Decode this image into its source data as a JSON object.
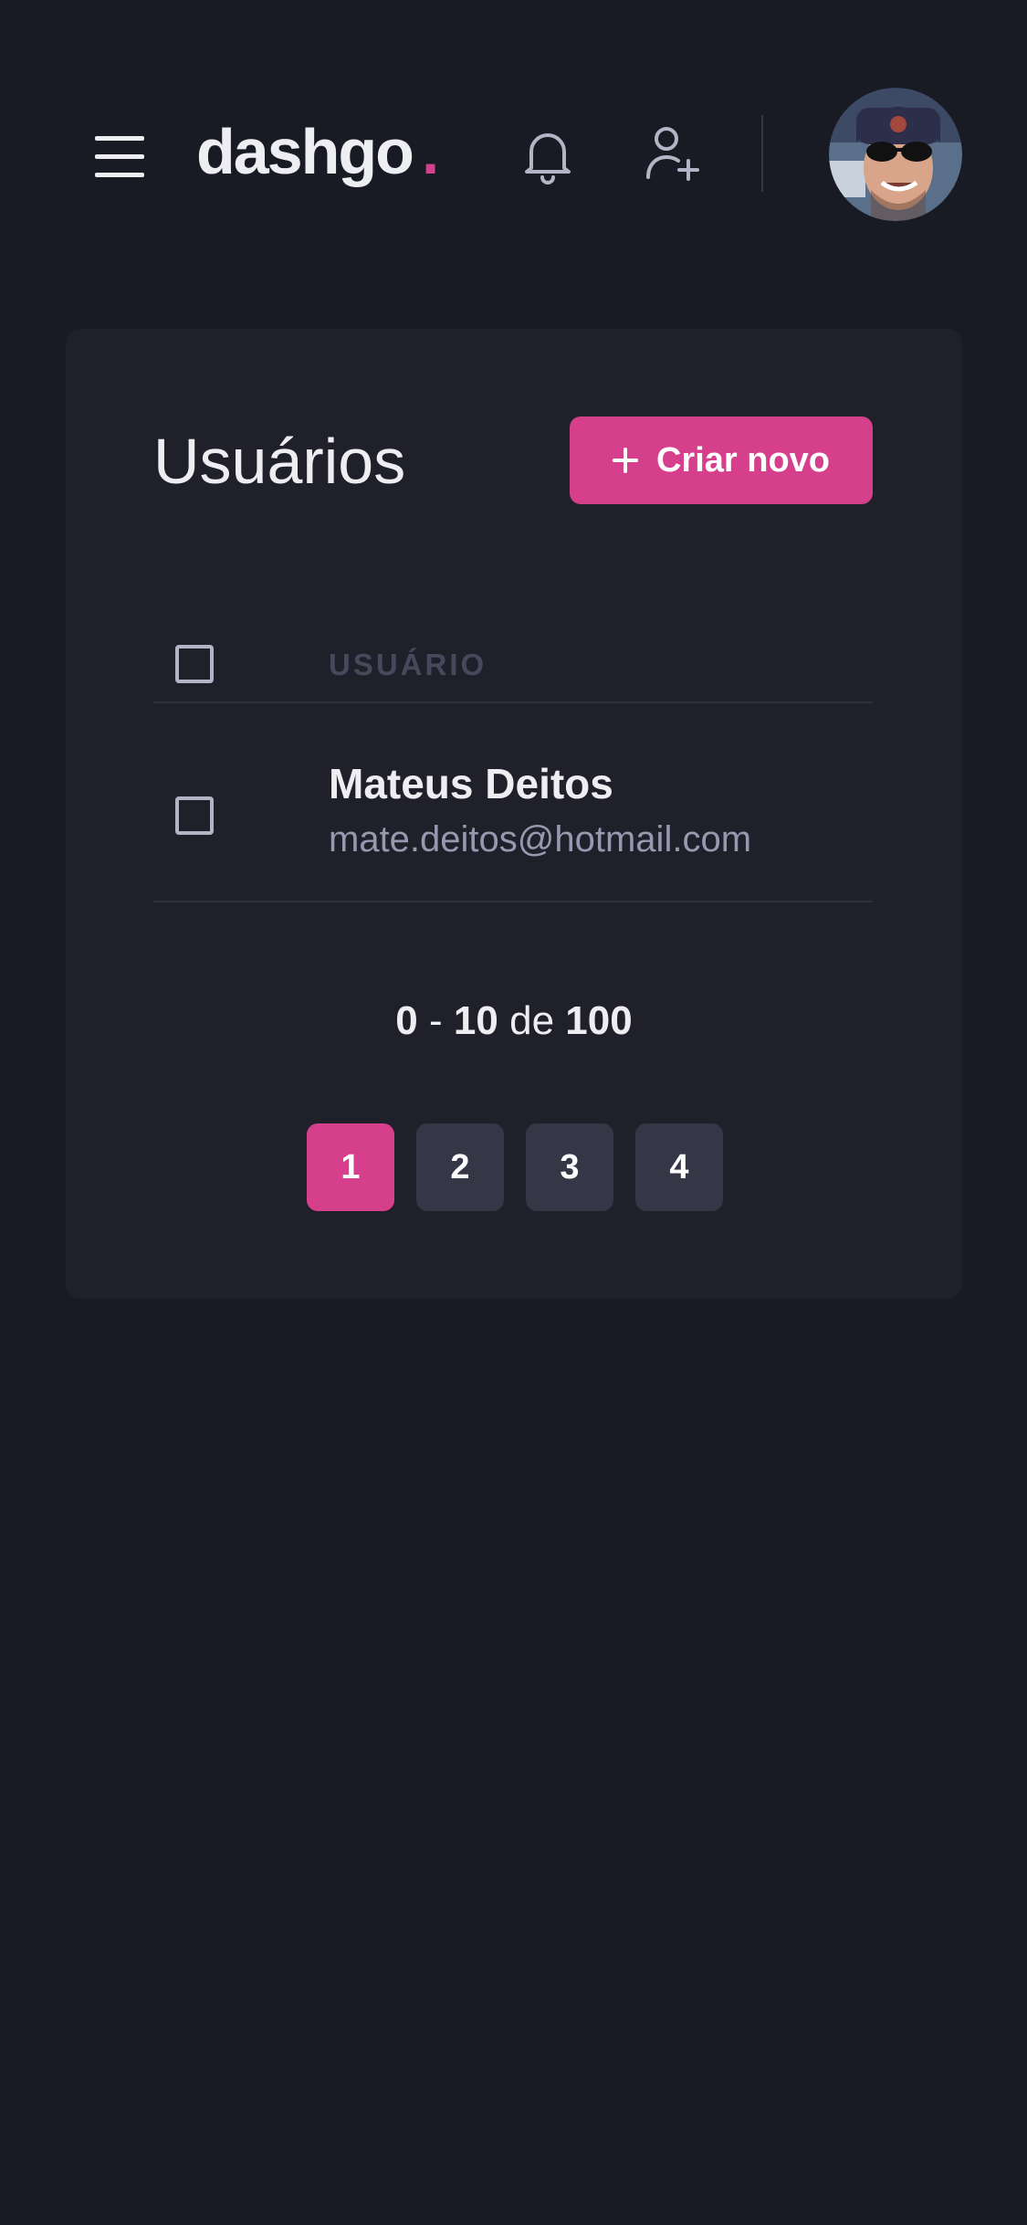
{
  "header": {
    "logo_text": "dashgo",
    "logo_dot": ".",
    "icons": [
      "menu-icon",
      "bell-icon",
      "user-add-icon"
    ],
    "avatar_alt": "avatar"
  },
  "users_panel": {
    "title": "Usuários",
    "create_button_label": "Criar novo",
    "table": {
      "columns": [
        "USUÁRIO"
      ],
      "rows": [
        {
          "name": "Mateus Deitos",
          "email": "mate.deitos@hotmail.com"
        }
      ]
    },
    "pagination": {
      "range_start": "0",
      "separator": "-",
      "range_end": "10",
      "of_label": "de",
      "total": "100",
      "pages": [
        "1",
        "2",
        "3",
        "4"
      ],
      "current_page": "1"
    }
  },
  "colors": {
    "background": "#181B23",
    "card": "#1F2029",
    "accent": "#D53F8C",
    "muted_text": "#9699B0",
    "button_gray": "#353646"
  }
}
